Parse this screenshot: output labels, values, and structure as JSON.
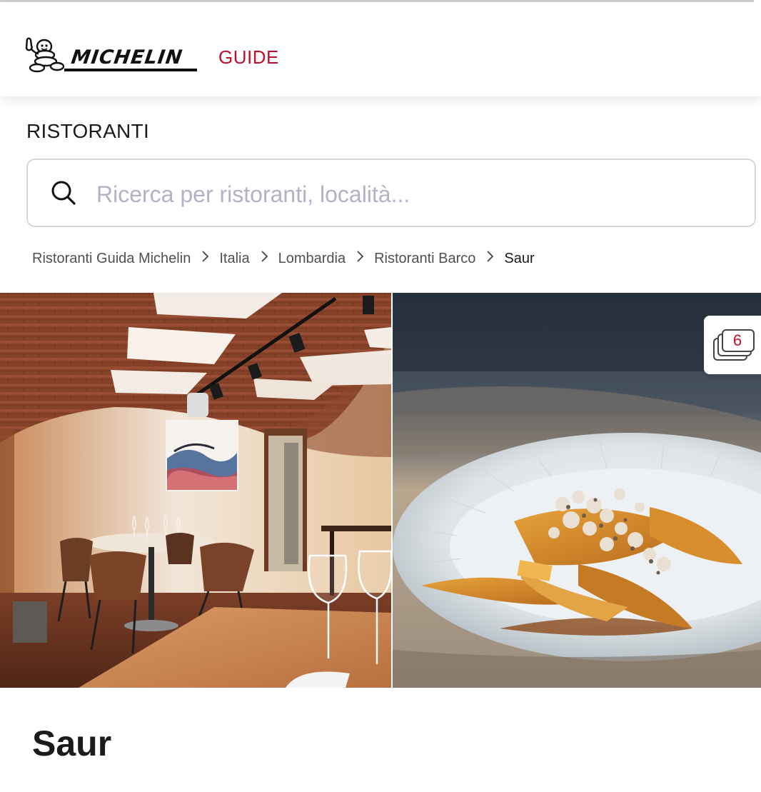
{
  "header": {
    "logo_wordmark": "MICHELIN",
    "logo_guide": "GUIDE",
    "brand_color": "#c0102a"
  },
  "section_title": "RISTORANTI",
  "search": {
    "placeholder": "Ricerca per ristoranti, località...",
    "value": ""
  },
  "breadcrumb": {
    "items": [
      "Ristoranti Guida Michelin",
      "Italia",
      "Lombardia",
      "Ristoranti Barco",
      "Saur"
    ],
    "separator_icon": "chevron-right-icon"
  },
  "gallery": {
    "photo_count": "6",
    "photos": [
      "dining-room-photo",
      "dish-photo"
    ]
  },
  "restaurant": {
    "name": "Saur"
  }
}
